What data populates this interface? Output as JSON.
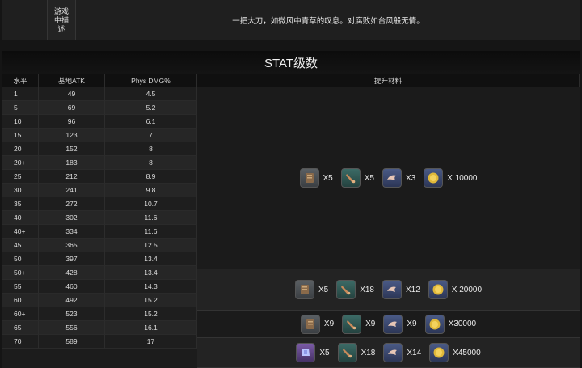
{
  "description": {
    "label": "游戏中描述",
    "text": "一把大刀，如微风中青草的叹息。对腐败如台风般无情。"
  },
  "table": {
    "title": "STAT级数",
    "headers": {
      "level": "水平",
      "atk": "基地ATK",
      "dmg": "Phys DMG%",
      "materials": "提升材料"
    },
    "rows": [
      {
        "level": "1",
        "atk": "49",
        "dmg": "4.5"
      },
      {
        "level": "5",
        "atk": "69",
        "dmg": "5.2"
      },
      {
        "level": "10",
        "atk": "96",
        "dmg": "6.1"
      },
      {
        "level": "15",
        "atk": "123",
        "dmg": "7"
      },
      {
        "level": "20",
        "atk": "152",
        "dmg": "8"
      },
      {
        "level": "20+",
        "atk": "183",
        "dmg": "8"
      },
      {
        "level": "25",
        "atk": "212",
        "dmg": "8.9"
      },
      {
        "level": "30",
        "atk": "241",
        "dmg": "9.8"
      },
      {
        "level": "35",
        "atk": "272",
        "dmg": "10.7"
      },
      {
        "level": "40",
        "atk": "302",
        "dmg": "11.6"
      },
      {
        "level": "40+",
        "atk": "334",
        "dmg": "11.6"
      },
      {
        "level": "45",
        "atk": "365",
        "dmg": "12.5"
      },
      {
        "level": "50",
        "atk": "397",
        "dmg": "13.4"
      },
      {
        "level": "50+",
        "atk": "428",
        "dmg": "13.4"
      },
      {
        "level": "55",
        "atk": "460",
        "dmg": "14.3"
      },
      {
        "level": "60",
        "atk": "492",
        "dmg": "15.2"
      },
      {
        "level": "60+",
        "atk": "523",
        "dmg": "15.2"
      },
      {
        "level": "65",
        "atk": "556",
        "dmg": "16.1"
      },
      {
        "level": "70",
        "atk": "589",
        "dmg": "17"
      }
    ],
    "materials": [
      {
        "items": [
          {
            "icon": "scroll-icon",
            "count": "X5"
          },
          {
            "icon": "horn-icon",
            "count": "X5"
          },
          {
            "icon": "claw-icon",
            "count": "X3"
          },
          {
            "icon": "coin-icon",
            "count": "X 10000"
          }
        ]
      },
      {
        "items": [
          {
            "icon": "scroll-icon",
            "count": "X5"
          },
          {
            "icon": "horn-icon",
            "count": "X18"
          },
          {
            "icon": "claw-icon",
            "count": "X12"
          },
          {
            "icon": "coin-icon",
            "count": "X 20000"
          }
        ]
      },
      {
        "items": [
          {
            "icon": "scroll-icon",
            "count": "X9"
          },
          {
            "icon": "horn-icon",
            "count": "X9"
          },
          {
            "icon": "claw-icon",
            "count": "X9"
          },
          {
            "icon": "coin-icon",
            "count": "X30000"
          }
        ]
      },
      {
        "items": [
          {
            "icon": "crystal-icon",
            "count": "X5"
          },
          {
            "icon": "horn-icon",
            "count": "X18"
          },
          {
            "icon": "claw-icon",
            "count": "X14"
          },
          {
            "icon": "coin-icon",
            "count": "X45000"
          }
        ]
      }
    ]
  },
  "colors": {
    "coin": "#e0b83a",
    "background": "#151515"
  }
}
